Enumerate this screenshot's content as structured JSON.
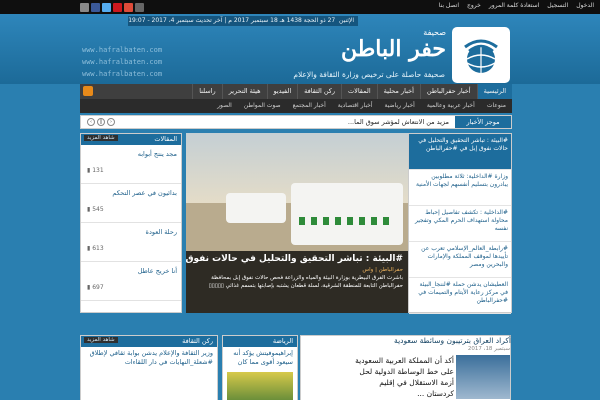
{
  "topbar": {
    "links": [
      "الدخول",
      "التسجيل",
      "استعادة كلمة المرور",
      "خروج",
      "اتصل بنا"
    ],
    "date": "الإثنين ⁩ 27 ذو الحجة 1438 هـ 18 سبتمبر 2017 م | آخر تحديث سبتمبر 4، 2017 - 19:07"
  },
  "header": {
    "site_small": "صحيفة",
    "site_name": "حفر الباطن",
    "tagline": "صحيفة حاصلة على ترخيص وزارة الثقافة والإعلام",
    "watermark": "www.hafralbaten.com"
  },
  "nav1": [
    "الرئيسية",
    "أخبار حفرالباطن",
    "أخبار محلية",
    "المقالات",
    "ركن الثقافة",
    "الفيديو",
    "هيئة التحرير",
    "راسلنا"
  ],
  "nav2": [
    "منوعات",
    "أخبار عربية وعالمية",
    "أخبار رياضية",
    "أخبار اقتصادية",
    "أخبار المجتمع",
    "صوت المواطن",
    "الصور"
  ],
  "ticker": {
    "label": "موجز الأخبار",
    "text": "مزيد من الانتعاش لمؤشر سوق الما..."
  },
  "left_box": {
    "title": "المقالات",
    "more": "شاهد المزيد",
    "items": [
      {
        "title": "مجد ينتج أبوابه",
        "count": "131"
      },
      {
        "title": "بدائيون في عصر التحكم",
        "count": "545"
      },
      {
        "title": "رحلة العودة",
        "count": "613"
      },
      {
        "title": "أنا خريج عاطل",
        "count": "697"
      }
    ]
  },
  "slider": {
    "title": "#البيئة : تباشر التحقيق والتحليل في حالات نفوق إبل في #حفرالباطن",
    "meta": "حفرالباطن | واس",
    "excerpt": "باشرت الفرق البيطرية بوزارة البيئة والمياه والزراعة فحص حالات نفوق إبل بمحافظة حفرالباطن التابعة للمنطقة الشرقية، لسلة قطعان يشتبه بإصابتها بتسمم غذائي ⁦▯▯▯▯▯"
  },
  "side_list": [
    "#البيئة : تباشر التحقيق والتحليل في حالات نفوق إبل في #حفرالباطن",
    "وزارة #الداخلية: ثلاثة مطلوبين يبادرون بتسليم أنفسهم لجهات الأمنية",
    "#الداخلية : تكشف تفاصيل إحباط محاولة استهداف الحرم المكي وتفجير نفسه",
    "#رابطة_العالم_الإسلامي تعرب عن تأييدها لموقف المملكة والإمارات والبحرين ومصر",
    "العطيشان يدشن حملة #لننجا_البيئة في مركز رعاية الأيتام والتميمات في #حفرالباطن"
  ],
  "bottom": {
    "culture_head": "ركن الثقافة",
    "culture_more": "شاهد المزيد",
    "culture_text": "وزير الثقافة والإعلام يدشن بوابة ثقافي لإطلاق #شعلة_النهايات في دار اللقاءات",
    "sports_head": "الرياضة",
    "sports_text": "إبراهيموفيتش يؤكد أنه سيعود أقوى مما كان",
    "feature_title": "أكراد العراق بترتيبون وسائطة سعودية",
    "feature_date": "سبتمبر 18، 2017",
    "feature_body": "أكد أن المملكة العربية السعودية على خط الوساطة الدولية لحل أزمة الاستقلال في إقليم كردستان ..."
  },
  "colors": {
    "accent": "#1d6d9d",
    "topbar": "#0f0f0f",
    "nav": "#3f3f3f",
    "overlay_meta": "#f0b55f"
  }
}
